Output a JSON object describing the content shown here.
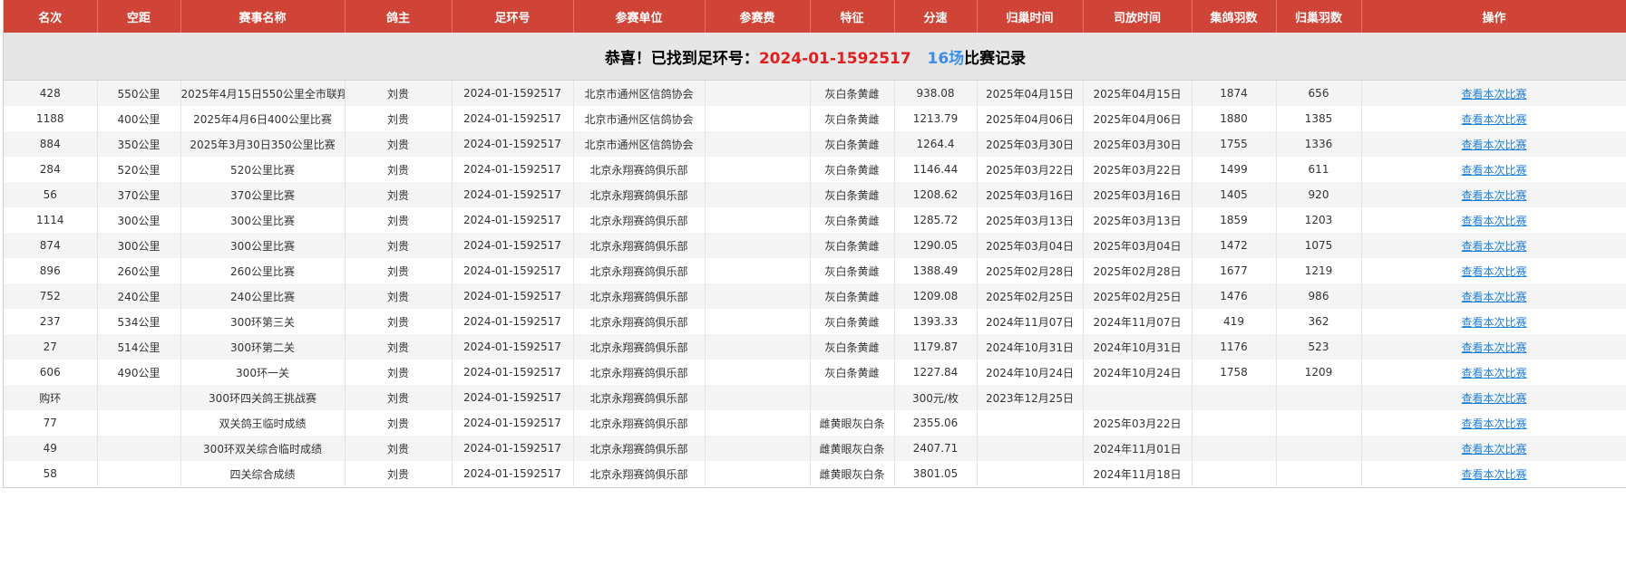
{
  "columns": [
    "名次",
    "空距",
    "赛事名称",
    "鸽主",
    "足环号",
    "参赛单位",
    "参赛费",
    "特征",
    "分速",
    "归巢时间",
    "司放时间",
    "集鸽羽数",
    "归巢羽数",
    "操作"
  ],
  "banner": {
    "prefix": "恭喜！已找到足环号：",
    "ring": "2024-01-1592517",
    "count": "16场",
    "suffix": "比赛记录"
  },
  "link_label": "查看本次比赛",
  "rows": [
    [
      "428",
      "550公里",
      "2025年4月15日550公里全市联翔",
      "刘贵",
      "2024-01-1592517",
      "北京市通州区信鸽协会",
      "",
      "灰白条黄雌",
      "938.08",
      "2025年04月15日",
      "2025年04月15日",
      "1874",
      "656"
    ],
    [
      "1188",
      "400公里",
      "2025年4月6日400公里比赛",
      "刘贵",
      "2024-01-1592517",
      "北京市通州区信鸽协会",
      "",
      "灰白条黄雌",
      "1213.79",
      "2025年04月06日",
      "2025年04月06日",
      "1880",
      "1385"
    ],
    [
      "884",
      "350公里",
      "2025年3月30日350公里比赛",
      "刘贵",
      "2024-01-1592517",
      "北京市通州区信鸽协会",
      "",
      "灰白条黄雌",
      "1264.4",
      "2025年03月30日",
      "2025年03月30日",
      "1755",
      "1336"
    ],
    [
      "284",
      "520公里",
      "520公里比赛",
      "刘贵",
      "2024-01-1592517",
      "北京永翔赛鸽俱乐部",
      "",
      "灰白条黄雌",
      "1146.44",
      "2025年03月22日",
      "2025年03月22日",
      "1499",
      "611"
    ],
    [
      "56",
      "370公里",
      "370公里比赛",
      "刘贵",
      "2024-01-1592517",
      "北京永翔赛鸽俱乐部",
      "",
      "灰白条黄雌",
      "1208.62",
      "2025年03月16日",
      "2025年03月16日",
      "1405",
      "920"
    ],
    [
      "1114",
      "300公里",
      "300公里比赛",
      "刘贵",
      "2024-01-1592517",
      "北京永翔赛鸽俱乐部",
      "",
      "灰白条黄雌",
      "1285.72",
      "2025年03月13日",
      "2025年03月13日",
      "1859",
      "1203"
    ],
    [
      "874",
      "300公里",
      "300公里比赛",
      "刘贵",
      "2024-01-1592517",
      "北京永翔赛鸽俱乐部",
      "",
      "灰白条黄雌",
      "1290.05",
      "2025年03月04日",
      "2025年03月04日",
      "1472",
      "1075"
    ],
    [
      "896",
      "260公里",
      "260公里比赛",
      "刘贵",
      "2024-01-1592517",
      "北京永翔赛鸽俱乐部",
      "",
      "灰白条黄雌",
      "1388.49",
      "2025年02月28日",
      "2025年02月28日",
      "1677",
      "1219"
    ],
    [
      "752",
      "240公里",
      "240公里比赛",
      "刘贵",
      "2024-01-1592517",
      "北京永翔赛鸽俱乐部",
      "",
      "灰白条黄雌",
      "1209.08",
      "2025年02月25日",
      "2025年02月25日",
      "1476",
      "986"
    ],
    [
      "237",
      "534公里",
      "300环第三关",
      "刘贵",
      "2024-01-1592517",
      "北京永翔赛鸽俱乐部",
      "",
      "灰白条黄雌",
      "1393.33",
      "2024年11月07日",
      "2024年11月07日",
      "419",
      "362"
    ],
    [
      "27",
      "514公里",
      "300环第二关",
      "刘贵",
      "2024-01-1592517",
      "北京永翔赛鸽俱乐部",
      "",
      "灰白条黄雌",
      "1179.87",
      "2024年10月31日",
      "2024年10月31日",
      "1176",
      "523"
    ],
    [
      "606",
      "490公里",
      "300环一关",
      "刘贵",
      "2024-01-1592517",
      "北京永翔赛鸽俱乐部",
      "",
      "灰白条黄雌",
      "1227.84",
      "2024年10月24日",
      "2024年10月24日",
      "1758",
      "1209"
    ],
    [
      "购环",
      "",
      "300环四关鸽王挑战赛",
      "刘贵",
      "2024-01-1592517",
      "北京永翔赛鸽俱乐部",
      "",
      "",
      "300元/枚",
      "2023年12月25日",
      "",
      "",
      ""
    ],
    [
      "77",
      "",
      "双关鸽王临时成绩",
      "刘贵",
      "2024-01-1592517",
      "北京永翔赛鸽俱乐部",
      "",
      "雌黄眼灰白条",
      "2355.06",
      "",
      "2025年03月22日",
      "",
      ""
    ],
    [
      "49",
      "",
      "300环双关综合临时成绩",
      "刘贵",
      "2024-01-1592517",
      "北京永翔赛鸽俱乐部",
      "",
      "雌黄眼灰白条",
      "2407.71",
      "",
      "2024年11月01日",
      "",
      ""
    ],
    [
      "58",
      "",
      "四关综合成绩",
      "刘贵",
      "2024-01-1592517",
      "北京永翔赛鸽俱乐部",
      "",
      "雌黄眼灰白条",
      "3801.05",
      "",
      "2024年11月18日",
      "",
      ""
    ]
  ],
  "colors": {
    "header_bg": "#d04437",
    "banner_bg": "#e6e6e6",
    "ring_red": "#e02020",
    "count_blue": "#3a8ee6",
    "link_blue": "#1e7fd8"
  }
}
